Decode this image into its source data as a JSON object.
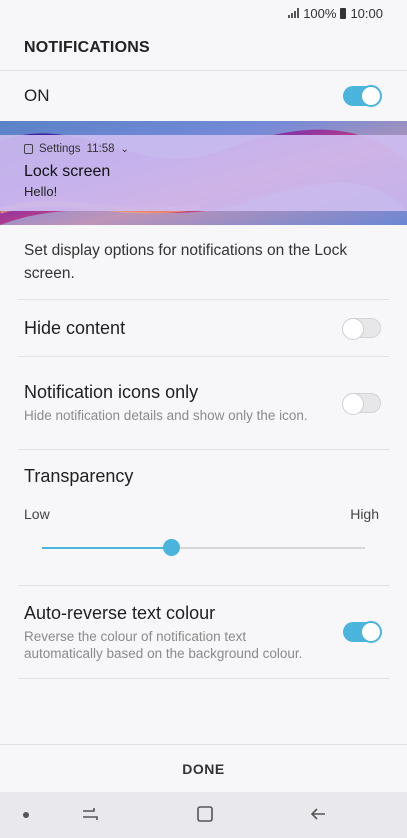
{
  "status_bar": {
    "battery": "100%",
    "time": "10:00"
  },
  "page": {
    "title": "NOTIFICATIONS"
  },
  "master_switch": {
    "label": "ON",
    "enabled": true
  },
  "preview": {
    "app_name": "Settings",
    "time": "11:58",
    "title": "Lock screen",
    "body": "Hello!"
  },
  "description": "Set display options for notifications on the Lock screen.",
  "settings": {
    "hide_content": {
      "label": "Hide content",
      "enabled": false
    },
    "icons_only": {
      "label": "Notification icons only",
      "sub": "Hide notification details and show only the icon.",
      "enabled": false
    },
    "transparency": {
      "label": "Transparency",
      "low": "Low",
      "high": "High",
      "level": 0.4
    },
    "auto_reverse": {
      "label": "Auto-reverse text colour",
      "sub": "Reverse the colour of notification text automatically based on the background colour.",
      "enabled": true
    }
  },
  "footer": {
    "done_label": "DONE"
  },
  "nav": {
    "icons": [
      "recent-apps-icon",
      "home-icon",
      "back-icon"
    ]
  },
  "colors": {
    "accent": "#4bb4dd",
    "preview_overlay": "#ccbcf0"
  }
}
